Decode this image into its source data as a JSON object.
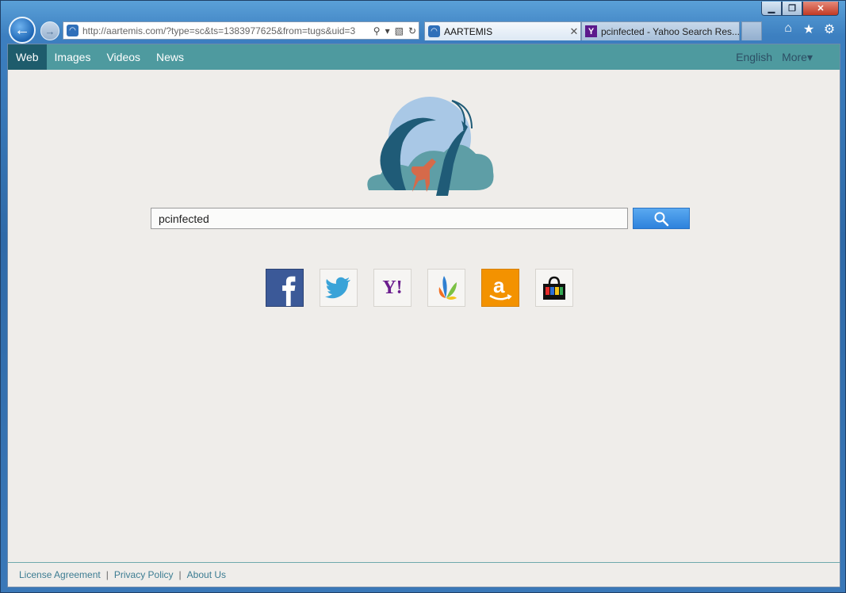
{
  "browser": {
    "address_url": "http://aartemis.com/?type=sc&ts=1383977625&from=tugs&uid=3",
    "tabs": [
      {
        "label": "AARTEMIS",
        "active": true
      },
      {
        "label": "pcinfected - Yahoo Search Res...",
        "active": false
      }
    ],
    "icons": [
      "back-arrow-icon",
      "forward-arrow-icon",
      "search-icon",
      "dropdown-icon",
      "compat-view-icon",
      "refresh-icon",
      "home-icon",
      "favorites-star-icon",
      "gear-icon"
    ]
  },
  "nav": {
    "items": [
      "Web",
      "Images",
      "Videos",
      "News"
    ],
    "selected": "Web",
    "language": "English",
    "more": "More▾"
  },
  "search": {
    "value": "pcinfected"
  },
  "shortcuts": [
    {
      "name": "facebook",
      "icon": "facebook-icon"
    },
    {
      "name": "twitter",
      "icon": "twitter-icon"
    },
    {
      "name": "yahoo",
      "icon": "yahoo-icon",
      "text": "Y!"
    },
    {
      "name": "msn",
      "icon": "msn-butterfly-icon"
    },
    {
      "name": "amazon",
      "icon": "amazon-icon",
      "text": "a"
    },
    {
      "name": "shopping",
      "icon": "shopping-bag-icon"
    }
  ],
  "footer": {
    "links": [
      "License Agreement",
      "Privacy Policy",
      "About Us"
    ],
    "separator": "|"
  },
  "colors": {
    "navbar": "#4e9a9f",
    "nav_selected": "#1e5c6c",
    "page_bg": "#efedea",
    "search_button": "#3a8fe3"
  }
}
